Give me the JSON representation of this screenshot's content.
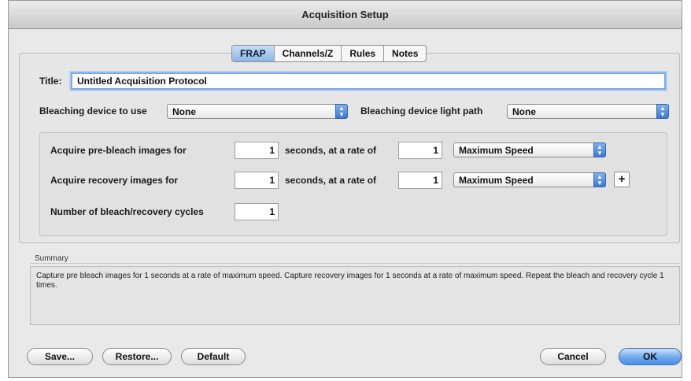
{
  "window": {
    "title": "Acquisition Setup"
  },
  "tabs": [
    "FRAP",
    "Channels/Z",
    "Rules",
    "Notes"
  ],
  "form": {
    "title_label": "Title:",
    "title_value": "Untitled Acquisition Protocol",
    "bleach_device_label": "Bleaching device to use",
    "bleach_device_value": "None",
    "light_path_label": "Bleaching device light path",
    "light_path_value": "None"
  },
  "acquire": {
    "prebleach_label": "Acquire pre-bleach images for",
    "prebleach_seconds": "1",
    "prebleach_rate_text": "seconds, at a rate of",
    "prebleach_rate": "1",
    "prebleach_speed": "Maximum Speed",
    "recovery_label": "Acquire recovery images for",
    "recovery_seconds": "1",
    "recovery_rate_text": "seconds, at a rate of",
    "recovery_rate": "1",
    "recovery_speed": "Maximum Speed",
    "plus_label": "+",
    "cycles_label": "Number of bleach/recovery cycles",
    "cycles_value": "1"
  },
  "summary": {
    "label": "Summary",
    "text": "Capture pre bleach images for 1 seconds at a rate of maximum speed. Capture recovery images for 1 seconds at a rate of maximum speed. Repeat the bleach and recovery cycle 1 times."
  },
  "buttons": {
    "save": "Save...",
    "restore": "Restore...",
    "default": "Default",
    "cancel": "Cancel",
    "ok": "OK"
  },
  "icons": {
    "select_arrow": "updown-arrow-icon"
  }
}
